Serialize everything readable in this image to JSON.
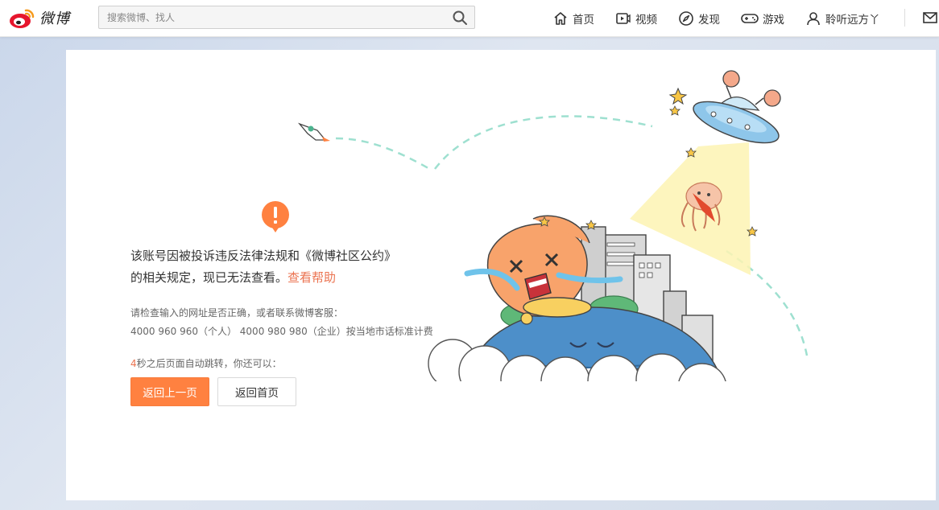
{
  "header": {
    "logo_text": "微博",
    "search": {
      "placeholder": "搜索微博、找人",
      "value": ""
    },
    "nav": [
      {
        "id": "home",
        "label": "首页",
        "icon": "home-icon"
      },
      {
        "id": "video",
        "label": "视频",
        "icon": "video-icon"
      },
      {
        "id": "discover",
        "label": "发现",
        "icon": "compass-icon"
      },
      {
        "id": "games",
        "label": "游戏",
        "icon": "gamepad-icon"
      },
      {
        "id": "user",
        "label": "聆听远方丫",
        "icon": "user-icon"
      }
    ],
    "mail_icon": "mail-icon"
  },
  "notice": {
    "icon": "alert-icon",
    "message_line1": "该账号因被投诉违反法律法规和《微博社区公约》",
    "message_line2": "的相关规定，现已无法查看。",
    "help_link": "查看帮助",
    "sub_line1": "请检查输入的网址是否正确，或者联系微博客服：",
    "sub_line2": "4000 960 960（个人） 4000 980 980（企业）按当地市话标准计费",
    "redirect_seconds": "4",
    "redirect_text": "秒之后页面自动跳转，你还可以：",
    "btn_back": "返回上一页",
    "btn_home": "返回首页"
  },
  "colors": {
    "accent": "#eb7350",
    "primary_button": "#ff8140",
    "alert_orange": "#ff8140"
  }
}
